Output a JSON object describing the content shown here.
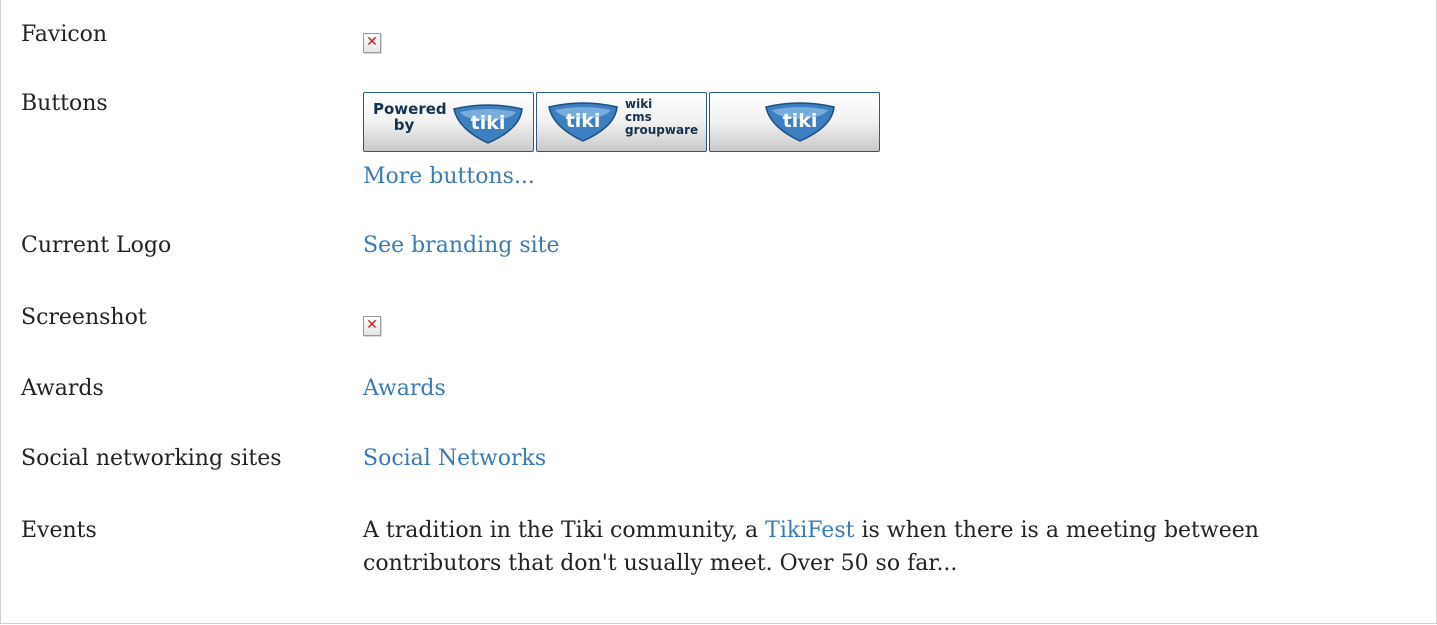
{
  "rows": {
    "favicon": {
      "label": "Favicon",
      "image_state": "broken"
    },
    "buttons": {
      "label": "Buttons",
      "badges": [
        {
          "name": "powered-by-tiki",
          "lines": [
            "Powered",
            "by"
          ],
          "mark": "tiki"
        },
        {
          "name": "tiki-wiki-cms-groupware",
          "lines": [
            "wiki",
            "cms",
            "groupware"
          ],
          "mark": "tiki"
        },
        {
          "name": "tiki-plain",
          "lines": [],
          "mark": "tiki"
        }
      ],
      "more_link": "More buttons..."
    },
    "current_logo": {
      "label": "Current Logo",
      "link": "See branding site"
    },
    "screenshot": {
      "label": "Screenshot",
      "image_state": "broken"
    },
    "awards": {
      "label": "Awards",
      "link": "Awards"
    },
    "social": {
      "label": "Social networking sites",
      "link": "Social Networks"
    },
    "events": {
      "label": "Events",
      "text_before": "A tradition in the Tiki community, a ",
      "link": "TikiFest",
      "text_after": " is when there is a meeting between contributors that don't usually meet. Over 50 so far..."
    }
  },
  "colors": {
    "link": "#3a7ab5",
    "text": "#222222",
    "border": "#cfcfcf",
    "badge_border": "#2a5a8a",
    "logo_blue": "#3d7fc0"
  },
  "icons": {
    "broken_image": "broken-image-icon",
    "tiki_logo": "tiki-logo-icon"
  }
}
